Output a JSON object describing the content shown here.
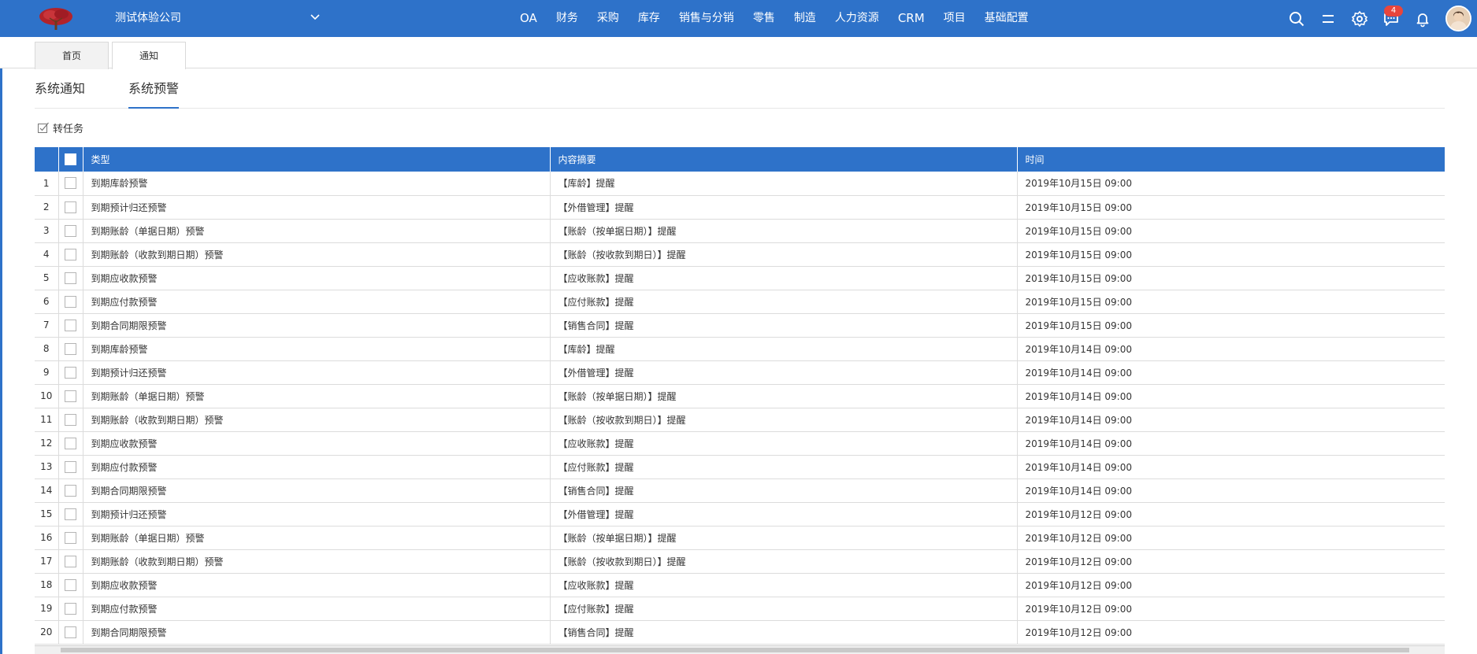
{
  "header": {
    "company": "测试体验公司",
    "nav": [
      "OA",
      "财务",
      "采购",
      "库存",
      "销售与分销",
      "零售",
      "制造",
      "人力资源",
      "CRM",
      "项目",
      "基础配置"
    ],
    "message_count": "4",
    "accent_color": "#2e72c9",
    "badge_color": "#e8453c",
    "icons": [
      "logo-tree-icon",
      "chevron-down-icon",
      "search-icon",
      "menu-lines-icon",
      "gear-icon",
      "chat-icon",
      "bell-icon",
      "avatar"
    ]
  },
  "page_tabs": [
    {
      "label": "首页",
      "active": false
    },
    {
      "label": "通知",
      "active": true
    }
  ],
  "sub_tabs": [
    {
      "label": "系统通知",
      "active": false
    },
    {
      "label": "系统预警",
      "active": true
    }
  ],
  "toolbar": {
    "to_task": "转任务"
  },
  "table": {
    "columns": [
      "类型",
      "内容摘要",
      "时间"
    ],
    "rows": [
      {
        "no": "1",
        "type": "到期库龄预警",
        "summary": "【库龄】提醒",
        "time": "2019年10月15日 09:00"
      },
      {
        "no": "2",
        "type": "到期预计归还预警",
        "summary": "【外借管理】提醒",
        "time": "2019年10月15日 09:00"
      },
      {
        "no": "3",
        "type": "到期账龄（单据日期）预警",
        "summary": "【账龄（按单据日期）】提醒",
        "time": "2019年10月15日 09:00"
      },
      {
        "no": "4",
        "type": "到期账龄（收款到期日期）预警",
        "summary": "【账龄（按收款到期日）】提醒",
        "time": "2019年10月15日 09:00"
      },
      {
        "no": "5",
        "type": "到期应收款预警",
        "summary": "【应收账款】提醒",
        "time": "2019年10月15日 09:00"
      },
      {
        "no": "6",
        "type": "到期应付款预警",
        "summary": "【应付账款】提醒",
        "time": "2019年10月15日 09:00"
      },
      {
        "no": "7",
        "type": "到期合同期限预警",
        "summary": "【销售合同】提醒",
        "time": "2019年10月15日 09:00"
      },
      {
        "no": "8",
        "type": "到期库龄预警",
        "summary": "【库龄】提醒",
        "time": "2019年10月14日 09:00"
      },
      {
        "no": "9",
        "type": "到期预计归还预警",
        "summary": "【外借管理】提醒",
        "time": "2019年10月14日 09:00"
      },
      {
        "no": "10",
        "type": "到期账龄（单据日期）预警",
        "summary": "【账龄（按单据日期）】提醒",
        "time": "2019年10月14日 09:00"
      },
      {
        "no": "11",
        "type": "到期账龄（收款到期日期）预警",
        "summary": "【账龄（按收款到期日）】提醒",
        "time": "2019年10月14日 09:00"
      },
      {
        "no": "12",
        "type": "到期应收款预警",
        "summary": "【应收账款】提醒",
        "time": "2019年10月14日 09:00"
      },
      {
        "no": "13",
        "type": "到期应付款预警",
        "summary": "【应付账款】提醒",
        "time": "2019年10月14日 09:00"
      },
      {
        "no": "14",
        "type": "到期合同期限预警",
        "summary": "【销售合同】提醒",
        "time": "2019年10月14日 09:00"
      },
      {
        "no": "15",
        "type": "到期预计归还预警",
        "summary": "【外借管理】提醒",
        "time": "2019年10月12日 09:00"
      },
      {
        "no": "16",
        "type": "到期账龄（单据日期）预警",
        "summary": "【账龄（按单据日期）】提醒",
        "time": "2019年10月12日 09:00"
      },
      {
        "no": "17",
        "type": "到期账龄（收款到期日期）预警",
        "summary": "【账龄（按收款到期日）】提醒",
        "time": "2019年10月12日 09:00"
      },
      {
        "no": "18",
        "type": "到期应收款预警",
        "summary": "【应收账款】提醒",
        "time": "2019年10月12日 09:00"
      },
      {
        "no": "19",
        "type": "到期应付款预警",
        "summary": "【应付账款】提醒",
        "time": "2019年10月12日 09:00"
      },
      {
        "no": "20",
        "type": "到期合同期限预警",
        "summary": "【销售合同】提醒",
        "time": "2019年10月12日 09:00"
      }
    ]
  }
}
